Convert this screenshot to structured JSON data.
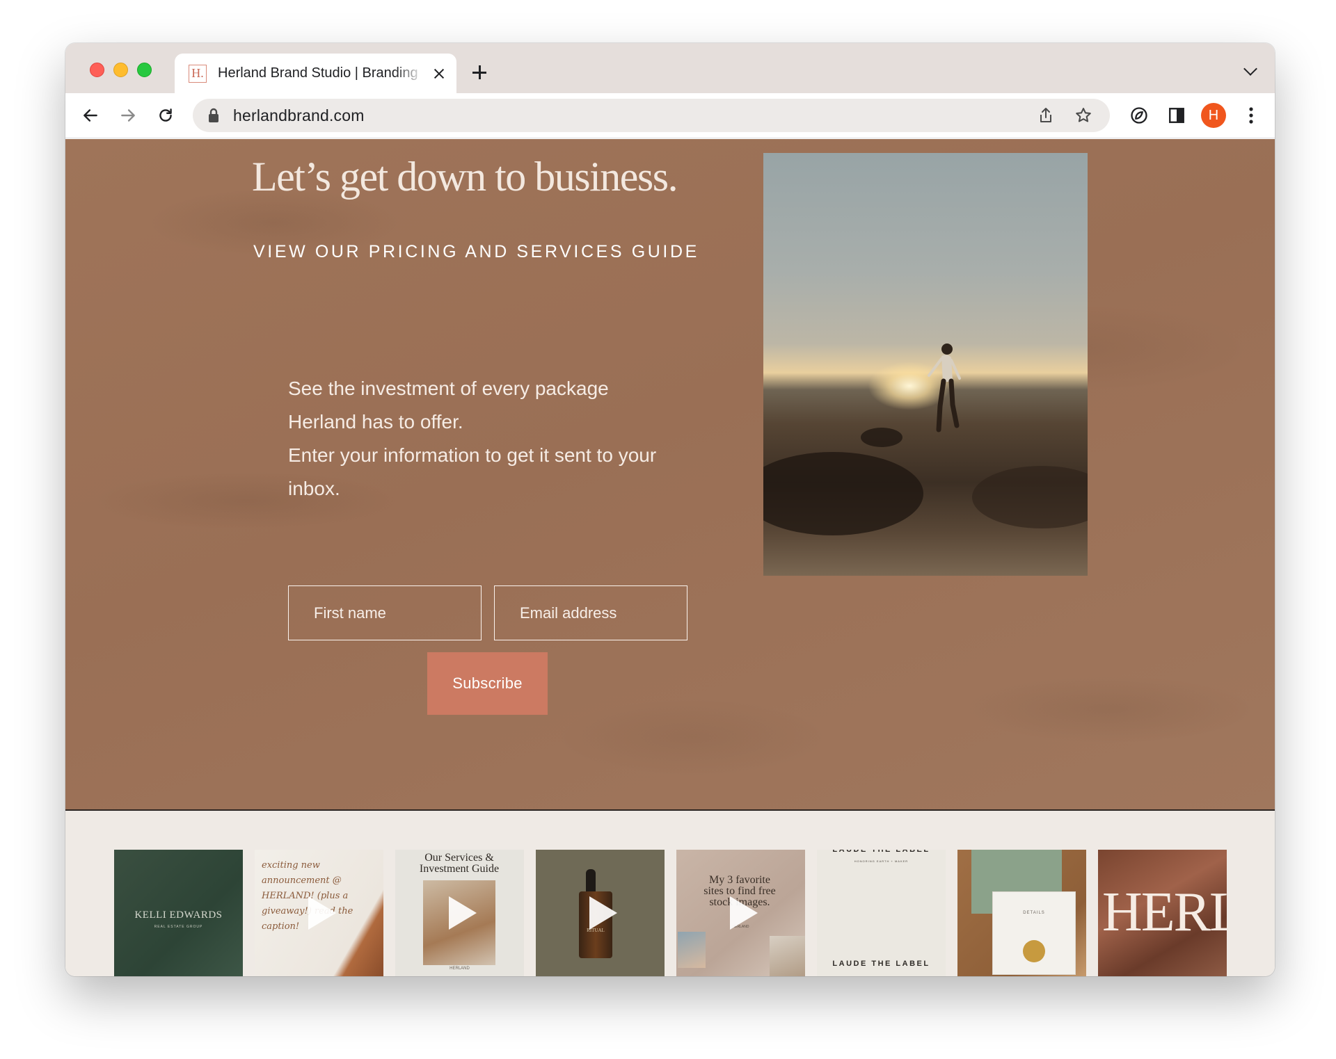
{
  "browser": {
    "tab_title": "Herland Brand Studio | Branding",
    "favicon_letter": "H.",
    "url": "herlandbrand.com",
    "profile_initial": "H"
  },
  "hero": {
    "headline": "Let’s get down to business.",
    "guide_link": "VIEW OUR PRICING AND SERVICES GUIDE",
    "description_line1": "See the investment of every package Herland has to offer.",
    "description_line2": "Enter your information to get it sent to your inbox.",
    "first_name_placeholder": "First name",
    "email_placeholder": "Email address",
    "subscribe_label": "Subscribe"
  },
  "instagram": {
    "tiles": [
      {
        "text": "KELLI EDWARDS",
        "subtext": "REAL ESTATE GROUP",
        "video": false
      },
      {
        "text": "exciting new announcement @ HERLAND! (plus a giveaway!) read the caption!",
        "video": true
      },
      {
        "text": "Our Services & Investment Guide",
        "subtext": "HERLAND",
        "video": true
      },
      {
        "text": "RITUAL",
        "video": true
      },
      {
        "text": "My 3 favorite sites to find free stock images.",
        "subtext": "HERLAND",
        "video": true
      },
      {
        "text": "LAUDE THE LABEL",
        "subtext": "HONORING EARTH + MAKER",
        "video": false
      },
      {
        "text": "DETAILS",
        "video": false
      },
      {
        "text": "HERL",
        "video": false
      }
    ]
  },
  "colors": {
    "hero_bg": "#9d7258",
    "accent": "#cc7a62",
    "strip_bg": "#efeae5"
  }
}
